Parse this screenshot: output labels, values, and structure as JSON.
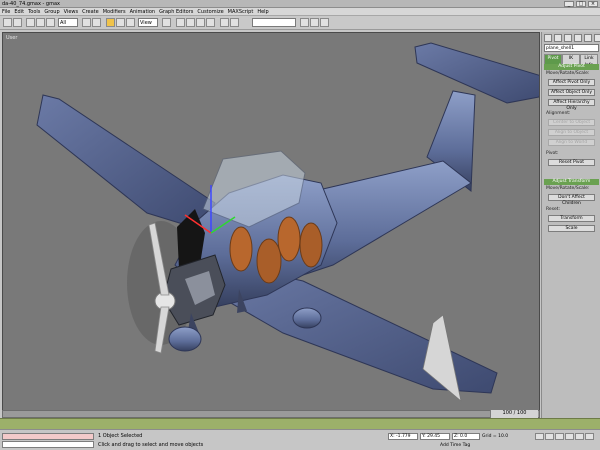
{
  "window": {
    "title": "da-40_74.gmax - gmax",
    "buttons": [
      "_",
      "□",
      "×"
    ]
  },
  "menu": [
    "File",
    "Edit",
    "Tools",
    "Group",
    "Views",
    "Create",
    "Modifiers",
    "Animation",
    "Graph Editors",
    "Customize",
    "MAXScript",
    "Help"
  ],
  "toolbar": {
    "selection_filter": "All",
    "coord_system": "View"
  },
  "viewport": {
    "label": "User"
  },
  "command_panel": {
    "object_name": "plane_shell1",
    "tabs": [
      "Pivot",
      "IK",
      "Link Info"
    ],
    "active_tab": "Pivot",
    "adjust_pivot": {
      "title": "Adjust Pivot",
      "subtitle": "Move/Rotate/Scale:",
      "buttons": [
        "Affect Pivot Only",
        "Affect Object Only",
        "Affect Hierarchy Only"
      ]
    },
    "alignment": {
      "title": "Alignment:",
      "buttons": [
        "Center to Object",
        "Align to Object",
        "Align to World"
      ]
    },
    "pivot": {
      "title": "Pivot:",
      "button": "Reset Pivot"
    },
    "adjust_transform": {
      "title": "Adjust Transform",
      "subtitle": "Move/Rotate/Scale:",
      "button": "Don't Affect Children"
    },
    "reset": {
      "title": "Reset:",
      "buttons": [
        "Transform",
        "Scale"
      ]
    }
  },
  "frame_counter": "100 / 100",
  "status": {
    "selected": "1 Object Selected",
    "prompt": "Click and drag to select and move objects",
    "x": "X: -1.779",
    "y": "Y: 29.45",
    "z": "Z: 0.0",
    "grid": "Grid = 10.0",
    "add_time_tag": "Add Time Tag"
  }
}
